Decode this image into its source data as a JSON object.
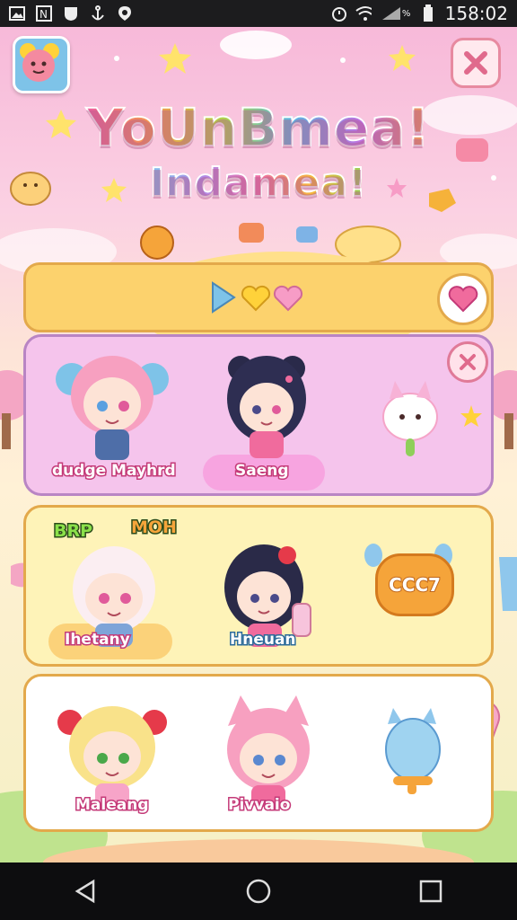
{
  "status_bar": {
    "time": "158:02",
    "signal_percent": "%"
  },
  "title": {
    "line1": "YoUnBmea!",
    "line2": "Indamea!"
  },
  "characters": [
    {
      "name": "dudge Mayhrd"
    },
    {
      "name": "Saeng"
    },
    {
      "name": "Ihetany"
    },
    {
      "name": "Hneuan"
    },
    {
      "name": "Maleang"
    },
    {
      "name": "Pivvaio"
    }
  ],
  "badges": {
    "left": "BRP",
    "right": "MOH"
  },
  "cccr_button": {
    "label": "CCC7"
  },
  "colors": {
    "accent_pink": "#f06b9d",
    "panel_pink": "#f5c4ec",
    "panel_yellow": "#fef3b8",
    "bar_gold": "#fcd26d"
  },
  "icons": [
    "avatar-icon",
    "close-icon",
    "play-icon",
    "heart-icon",
    "back-icon",
    "home-icon",
    "recents-icon"
  ]
}
